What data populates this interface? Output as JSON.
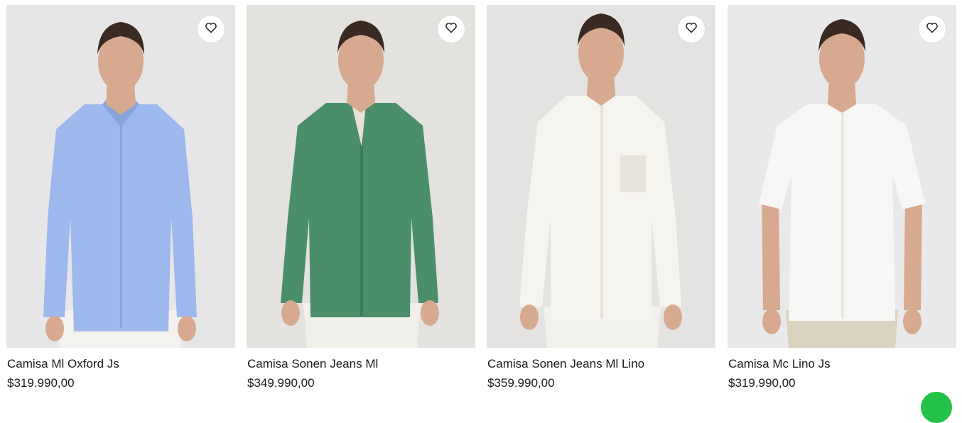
{
  "products": [
    {
      "name": "Camisa Ml Oxford Js",
      "price": "$319.990,00",
      "shirt_color": "#9db8ec",
      "shirt_shade": "#86a3dc",
      "pants_color": "#f4f2ee",
      "bg_color": "#e6e6e8",
      "wishlist_icon": "heart-icon"
    },
    {
      "name": "Camisa Sonen Jeans Ml",
      "price": "$349.990,00",
      "shirt_color": "#4a8f6a",
      "shirt_shade": "#3c7a59",
      "pants_color": "#f1efe9",
      "bg_color": "#e3e2de",
      "wishlist_icon": "heart-icon"
    },
    {
      "name": "Camisa Sonen Jeans Ml Lino",
      "price": "$359.990,00",
      "shirt_color": "#f6f4ee",
      "shirt_shade": "#e6e3da",
      "pants_color": "#f3f1ec",
      "bg_color": "#e4e3e1",
      "wishlist_icon": "heart-icon"
    },
    {
      "name": "Camisa Mc Lino Js",
      "price": "$319.990,00",
      "shirt_color": "#f7f7f5",
      "shirt_shade": "#e8e7e3",
      "pants_color": "#d8d2bf",
      "bg_color": "#e9e9ea",
      "wishlist_icon": "heart-icon"
    }
  ],
  "colors": {
    "text": "#1a1a1a",
    "skin": "#d7a98e",
    "hair": "#3b2a22",
    "badge": "#25c24a"
  }
}
